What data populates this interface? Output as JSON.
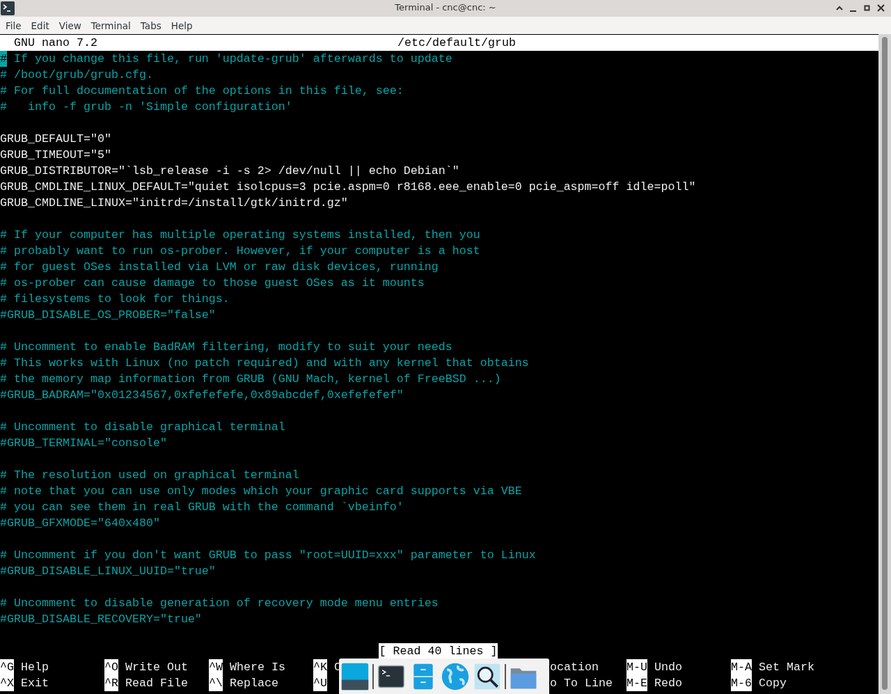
{
  "window": {
    "title": "Terminal - cnc@cnc: ~"
  },
  "menu": [
    "File",
    "Edit",
    "View",
    "Terminal",
    "Tabs",
    "Help"
  ],
  "nano": {
    "version": "GNU nano 7.2",
    "filename": "/etc/default/grub",
    "lines": [
      {
        "kind": "comment",
        "text": "# If you change this file, run 'update-grub' afterwards to update",
        "cursor": true
      },
      {
        "kind": "comment",
        "text": "# /boot/grub/grub.cfg.",
        "cursor": false
      },
      {
        "kind": "comment",
        "text": "# For full documentation of the options in this file, see:",
        "cursor": false
      },
      {
        "kind": "comment",
        "text": "#   info -f grub -n 'Simple configuration'",
        "cursor": false
      },
      {
        "kind": "blank"
      },
      {
        "kind": "code",
        "text": "GRUB_DEFAULT=\"0\"",
        "cursor": false
      },
      {
        "kind": "code",
        "text": "GRUB_TIMEOUT=\"5\"",
        "cursor": false
      },
      {
        "kind": "code",
        "text": "GRUB_DISTRIBUTOR=\"`lsb_release -i -s 2> /dev/null || echo Debian`\"",
        "cursor": false
      },
      {
        "kind": "code",
        "text": "GRUB_CMDLINE_LINUX_DEFAULT=\"quiet isolcpus=3 pcie.aspm=0 r8168.eee_enable=0 pcie_aspm=off idle=poll\"",
        "cursor": false
      },
      {
        "kind": "code",
        "text": "GRUB_CMDLINE_LINUX=\"initrd=/install/gtk/initrd.gz\"",
        "cursor": false
      },
      {
        "kind": "blank"
      },
      {
        "kind": "comment",
        "text": "# If your computer has multiple operating systems installed, then you",
        "cursor": false
      },
      {
        "kind": "comment",
        "text": "# probably want to run os-prober. However, if your computer is a host",
        "cursor": false
      },
      {
        "kind": "comment",
        "text": "# for guest OSes installed via LVM or raw disk devices, running",
        "cursor": false
      },
      {
        "kind": "comment",
        "text": "# os-prober can cause damage to those guest OSes as it mounts",
        "cursor": false
      },
      {
        "kind": "comment",
        "text": "# filesystems to look for things.",
        "cursor": false
      },
      {
        "kind": "comment",
        "text": "#GRUB_DISABLE_OS_PROBER=\"false\"",
        "cursor": false
      },
      {
        "kind": "blank"
      },
      {
        "kind": "comment",
        "text": "# Uncomment to enable BadRAM filtering, modify to suit your needs",
        "cursor": false
      },
      {
        "kind": "comment",
        "text": "# This works with Linux (no patch required) and with any kernel that obtains",
        "cursor": false
      },
      {
        "kind": "comment",
        "text": "# the memory map information from GRUB (GNU Mach, kernel of FreeBSD ...)",
        "cursor": false
      },
      {
        "kind": "comment",
        "text": "#GRUB_BADRAM=\"0x01234567,0xfefefefe,0x89abcdef,0xefefefef\"",
        "cursor": false
      },
      {
        "kind": "blank"
      },
      {
        "kind": "comment",
        "text": "# Uncomment to disable graphical terminal",
        "cursor": false
      },
      {
        "kind": "comment",
        "text": "#GRUB_TERMINAL=\"console\"",
        "cursor": false
      },
      {
        "kind": "blank"
      },
      {
        "kind": "comment",
        "text": "# The resolution used on graphical terminal",
        "cursor": false
      },
      {
        "kind": "comment",
        "text": "# note that you can use only modes which your graphic card supports via VBE",
        "cursor": false
      },
      {
        "kind": "comment",
        "text": "# you can see them in real GRUB with the command `vbeinfo'",
        "cursor": false
      },
      {
        "kind": "comment",
        "text": "#GRUB_GFXMODE=\"640x480\"",
        "cursor": false
      },
      {
        "kind": "blank"
      },
      {
        "kind": "comment",
        "text": "# Uncomment if you don't want GRUB to pass \"root=UUID=xxx\" parameter to Linux",
        "cursor": false
      },
      {
        "kind": "comment",
        "text": "#GRUB_DISABLE_LINUX_UUID=\"true\"",
        "cursor": false
      },
      {
        "kind": "blank"
      },
      {
        "kind": "comment",
        "text": "# Uncomment to disable generation of recovery mode menu entries",
        "cursor": false
      },
      {
        "kind": "comment",
        "text": "#GRUB_DISABLE_RECOVERY=\"true\"",
        "cursor": false
      }
    ],
    "status": "[ Read 40 lines ]",
    "shortcuts": [
      [
        {
          "key": "^G",
          "label": "Help"
        },
        {
          "key": "^X",
          "label": "Exit"
        }
      ],
      [
        {
          "key": "^O",
          "label": "Write Out"
        },
        {
          "key": "^R",
          "label": "Read File"
        }
      ],
      [
        {
          "key": "^W",
          "label": "Where Is"
        },
        {
          "key": "^\\",
          "label": "Replace"
        }
      ],
      [
        {
          "key": "^K",
          "label": "C"
        },
        {
          "key": "^U"
        }
      ],
      [
        {
          "label": "ocation"
        },
        {
          "label": "o To Line"
        }
      ],
      [
        {
          "key": "M-U",
          "label": "Undo"
        },
        {
          "key": "M-E",
          "label": "Redo"
        }
      ],
      [
        {
          "key": "M-A",
          "label": "Set Mark"
        },
        {
          "key": "M-6",
          "label": "Copy"
        }
      ]
    ]
  },
  "dock": {
    "items": [
      {
        "kind": "tile"
      },
      {
        "kind": "separator"
      },
      {
        "kind": "terminal"
      },
      {
        "kind": "cabinet"
      },
      {
        "kind": "globe"
      },
      {
        "kind": "search"
      },
      {
        "kind": "separator"
      },
      {
        "kind": "folder"
      }
    ]
  }
}
